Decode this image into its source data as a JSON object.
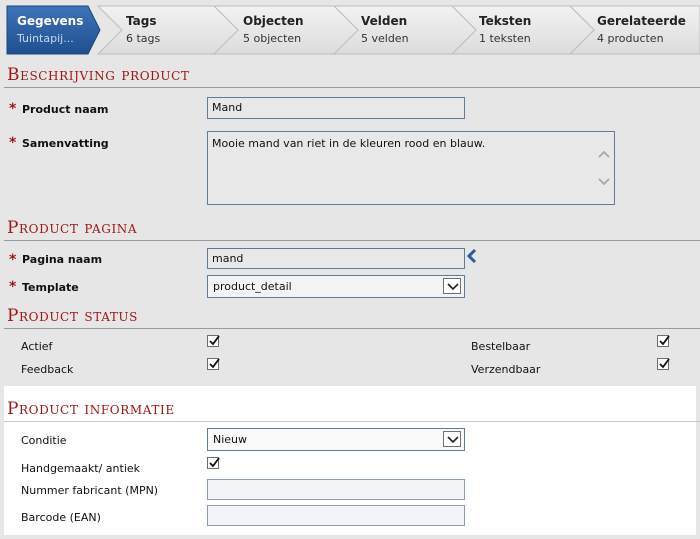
{
  "steps": [
    {
      "title": "Gegevens",
      "subtitle": "Tuintapij...",
      "active": true
    },
    {
      "title": "Tags",
      "subtitle": "6 tags",
      "active": false
    },
    {
      "title": "Objecten",
      "subtitle": "5 objecten",
      "active": false
    },
    {
      "title": "Velden",
      "subtitle": "5 velden",
      "active": false
    },
    {
      "title": "Teksten",
      "subtitle": "1 teksten",
      "active": false
    },
    {
      "title": "Gerelateerde",
      "subtitle": "4 producten",
      "active": false
    }
  ],
  "sections": {
    "beschrijving": {
      "title": "Beschrijving product",
      "product_naam_label": "Product naam",
      "product_naam_value": "Mand",
      "samenvatting_label": "Samenvatting",
      "samenvatting_value": "Mooie mand van riet in de kleuren rood en blauw."
    },
    "pagina": {
      "title": "Product pagina",
      "pagina_naam_label": "Pagina naam",
      "pagina_naam_value": "mand",
      "template_label": "Template",
      "template_value": "product_detail"
    },
    "status": {
      "title": "Product status",
      "actief_label": "Actief",
      "actief_checked": true,
      "feedback_label": "Feedback",
      "feedback_checked": true,
      "bestelbaar_label": "Bestelbaar",
      "bestelbaar_checked": true,
      "verzendbaar_label": "Verzendbaar",
      "verzendbaar_checked": true
    },
    "informatie": {
      "title": "Product informatie",
      "conditie_label": "Conditie",
      "conditie_value": "Nieuw",
      "handgemaakt_label": "Handgemaakt/ antiek",
      "handgemaakt_checked": true,
      "mpn_label": "Nummer fabricant (MPN)",
      "mpn_value": "",
      "ean_label": "Barcode (EAN)",
      "ean_value": ""
    }
  },
  "colors": {
    "active_step": "#2e5e9e",
    "inactive_step": "#e4e4e4",
    "section_title": "#a01616",
    "required_star": "#a01616"
  }
}
